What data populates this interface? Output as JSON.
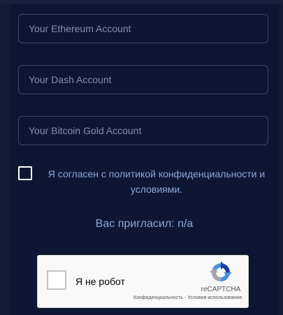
{
  "form": {
    "ethereum_placeholder": "Your Ethereum Account",
    "dash_placeholder": "Your Dash Account",
    "bitcoin_gold_placeholder": "Your Bitcoin Gold Account",
    "consent_text": "Я согласен с политикой конфиденциальности и условиями.",
    "invited_text": "Вас пригласил: n/a"
  },
  "recaptcha": {
    "checkbox_label": "Я не робот",
    "brand": "reCAPTCHA",
    "privacy_link": "Конфиденциальность",
    "separator": " - ",
    "terms_link": "Условия использования",
    "logo_icon": "recaptcha-logo-icon"
  },
  "colors": {
    "background": "#121c34",
    "panel": "#0d1733",
    "field_border": "#3a4766",
    "placeholder": "#7f8eac",
    "accent_text": "#8da6d8"
  }
}
